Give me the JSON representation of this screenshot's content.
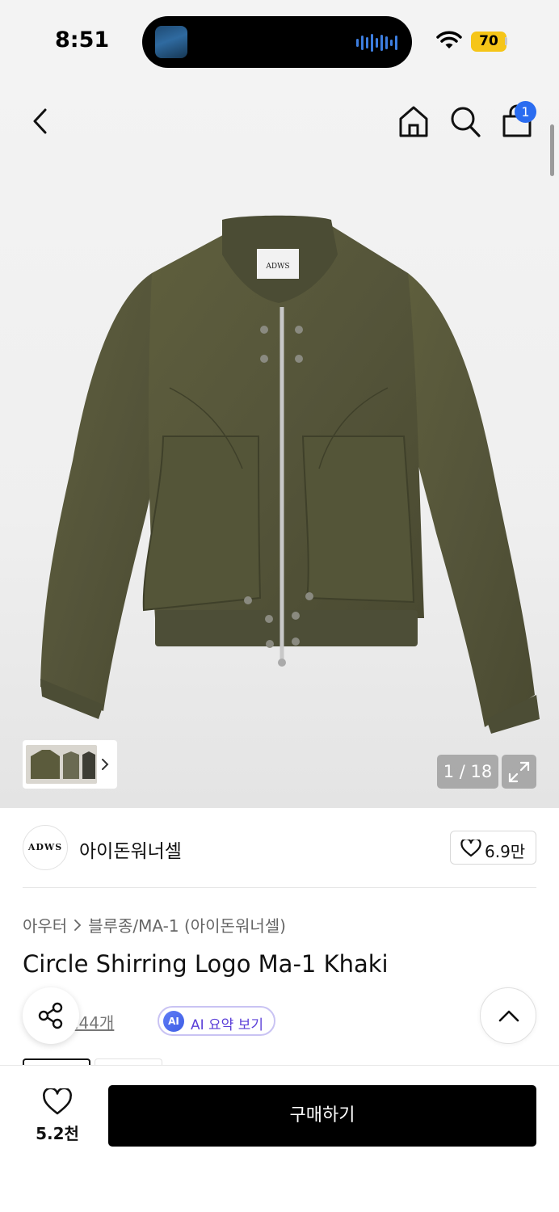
{
  "status_bar": {
    "time": "8:51",
    "battery": "70"
  },
  "nav": {
    "cart_count": "1"
  },
  "gallery": {
    "page_counter": "1 / 18",
    "logo_text": "ADWS"
  },
  "brand": {
    "logo_text": "ADWS",
    "name": "아이돈워너셀",
    "like_count": "6.9만"
  },
  "product": {
    "breadcrumb": [
      "아우터",
      "블루종/MA-1 (아이돈워너셀)"
    ],
    "title": "Circle Shirring Logo Ma-1 Khaki",
    "review_link": "기 144개",
    "ai_badge": "AI",
    "ai_summary_label": "AI 요약 보기"
  },
  "bottom_bar": {
    "wish_count": "5.2천",
    "buy_label": "구매하기"
  },
  "colors": {
    "accent_blue": "#2a6cf0",
    "battery_yellow": "#f5c518",
    "ai_purple": "#5b3fd8",
    "jacket_khaki": "#5a5a3a"
  }
}
